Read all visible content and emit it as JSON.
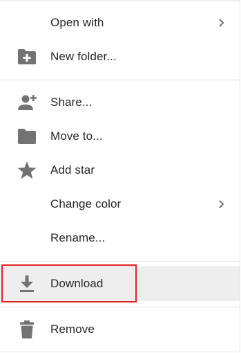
{
  "menu": {
    "items": [
      {
        "label": "Open with",
        "icon": "none",
        "submenu": true
      },
      {
        "label": "New folder...",
        "icon": "folder-plus-icon",
        "submenu": false
      },
      {
        "label": "Share...",
        "icon": "person-add-icon",
        "submenu": false
      },
      {
        "label": "Move to...",
        "icon": "folder-icon",
        "submenu": false
      },
      {
        "label": "Add star",
        "icon": "star-icon",
        "submenu": false
      },
      {
        "label": "Change color",
        "icon": "none",
        "submenu": true
      },
      {
        "label": "Rename...",
        "icon": "none",
        "submenu": false
      },
      {
        "label": "Download",
        "icon": "download-icon",
        "submenu": false
      },
      {
        "label": "Remove",
        "icon": "trash-icon",
        "submenu": false
      }
    ]
  },
  "colors": {
    "icon": "#737373",
    "text": "#262626",
    "highlight_background": "#eeeeee",
    "focus_outline": "#e52222"
  }
}
